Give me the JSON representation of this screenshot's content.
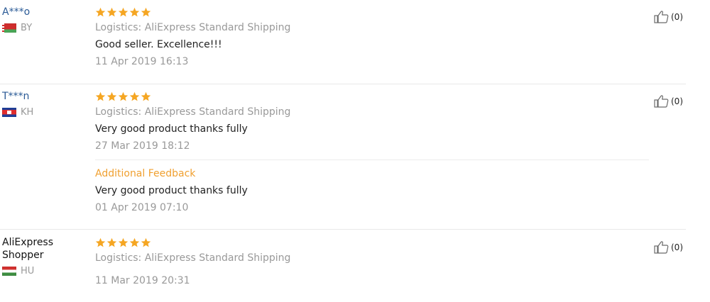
{
  "colors": {
    "star": "#f5a623",
    "link": "#2a5a96",
    "muted": "#999999",
    "additional": "#f0a030"
  },
  "reviews": [
    {
      "user": "A***o",
      "country": "BY",
      "rating": 5,
      "logistics": "Logistics: AliExpress Standard Shipping",
      "text": "Good seller. Excellence!!!",
      "date": "11 Apr 2019 16:13",
      "likes": "(0)"
    },
    {
      "user": "T***n",
      "country": "KH",
      "rating": 5,
      "logistics": "Logistics: AliExpress Standard Shipping",
      "text": "Very good product thanks fully",
      "date": "27 Mar 2019 18:12",
      "additional_title": "Additional Feedback",
      "additional_text": "Very good product thanks fully",
      "additional_date": "01 Apr 2019 07:10",
      "likes": "(0)"
    },
    {
      "user": "AliExpress Shopper",
      "country": "HU",
      "rating": 5,
      "logistics": "Logistics: AliExpress Standard Shipping",
      "date": "11 Mar 2019 20:31",
      "likes": "(0)"
    }
  ]
}
